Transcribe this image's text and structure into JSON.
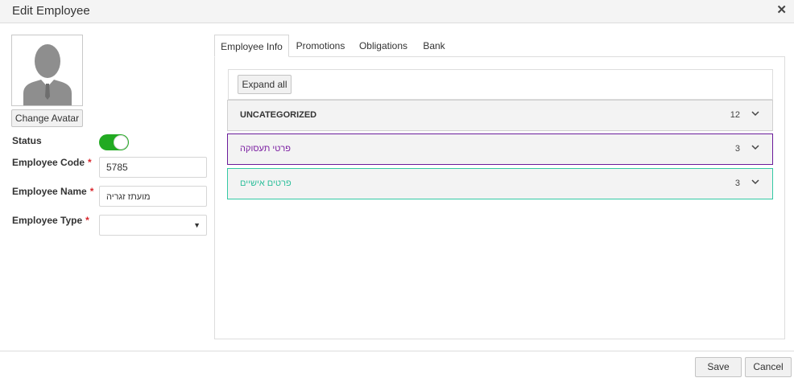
{
  "dialog": {
    "title": "Edit Employee",
    "close_label": "✕"
  },
  "avatar": {
    "change_label": "Change Avatar"
  },
  "form": {
    "status_label": "Status",
    "status_on": true,
    "code_label": "Employee Code",
    "code_value": "5785",
    "name_label": "Employee Name",
    "name_value": "מועתז  זגריה",
    "type_label": "Employee Type",
    "type_value": "",
    "required_mark": "*"
  },
  "tabs": [
    {
      "label": "Employee Info",
      "active": true
    },
    {
      "label": "Promotions",
      "active": false
    },
    {
      "label": "Obligations",
      "active": false
    },
    {
      "label": "Bank",
      "active": false
    }
  ],
  "toolbar": {
    "expand_label": "Expand all"
  },
  "groups": [
    {
      "name": "UNCATEGORIZED",
      "count": "12",
      "color": "#cfcfcf"
    },
    {
      "name": "פרטי תעסוקה",
      "count": "3",
      "color": "#6a1b9a"
    },
    {
      "name": "פרטים אישיים",
      "count": "3",
      "color": "#34c9a4"
    }
  ],
  "footer": {
    "save_label": "Save",
    "cancel_label": "Cancel"
  },
  "colors": {
    "toggle_on": "#22aa22",
    "required": "#d9262c"
  }
}
